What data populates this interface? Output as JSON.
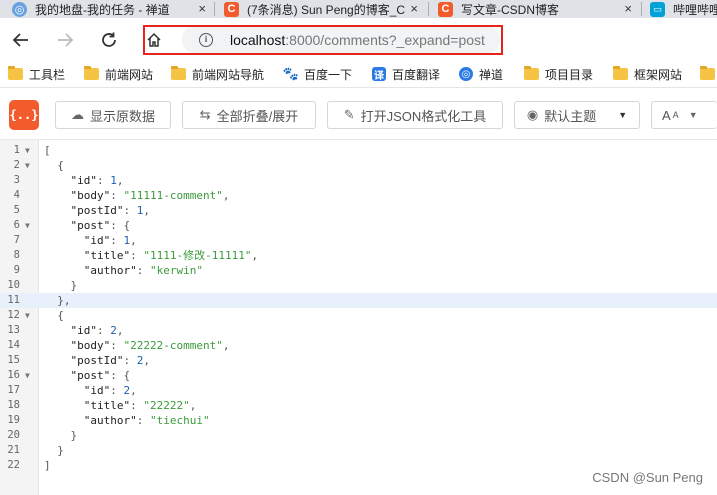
{
  "tabs": [
    {
      "title": "我的地盘-我的任务 - 禅道",
      "icon": "zentao-icon",
      "color": "#6aa1e0",
      "glyph": "禅"
    },
    {
      "title": "(7条消息) Sun Peng的博客_C",
      "icon": "csdn-icon",
      "color": "#f25c2c",
      "glyph": "C"
    },
    {
      "title": "写文章-CSDN博客",
      "icon": "csdn-icon",
      "color": "#f25c2c",
      "glyph": "C"
    },
    {
      "title": "哔哩哔哩",
      "icon": "bilibili-icon",
      "color": "#00a1d6",
      "glyph": "⌂"
    }
  ],
  "address": {
    "host": "localhost",
    "rest": ":8000/comments?_expand=post"
  },
  "bookmarks": [
    {
      "label": "工具栏",
      "icon": "folder-icon"
    },
    {
      "label": "前端网站",
      "icon": "folder-icon"
    },
    {
      "label": "前端网站导航",
      "icon": "folder-icon"
    },
    {
      "label": "百度一下",
      "icon": "baidu-icon"
    },
    {
      "label": "百度翻译",
      "icon": "translate-icon"
    },
    {
      "label": "禅道",
      "icon": "zentao-icon"
    },
    {
      "label": "项目目录",
      "icon": "folder-icon"
    },
    {
      "label": "框架网站",
      "icon": "folder-icon"
    }
  ],
  "toolbar": {
    "logo": "{..}",
    "raw_label": "显示原数据",
    "fold_label": "全部折叠/展开",
    "open_tool_label": "打开JSON格式化工具",
    "theme_label": "默认主题",
    "font_label": "A"
  },
  "code_lines": [
    {
      "n": "1",
      "fold": true,
      "html": "<span class='p'>[</span>"
    },
    {
      "n": "2",
      "fold": true,
      "html": "  <span class='p'>{</span>"
    },
    {
      "n": "3",
      "fold": false,
      "html": "    <span class='k'>\"id\"</span><span class='p'>: </span><span class='n'>1</span><span class='p'>,</span>"
    },
    {
      "n": "4",
      "fold": false,
      "html": "    <span class='k'>\"body\"</span><span class='p'>: </span><span class='s'>\"11111-comment\"</span><span class='p'>,</span>"
    },
    {
      "n": "5",
      "fold": false,
      "html": "    <span class='k'>\"postId\"</span><span class='p'>: </span><span class='n'>1</span><span class='p'>,</span>"
    },
    {
      "n": "6",
      "fold": true,
      "html": "    <span class='k'>\"post\"</span><span class='p'>: {</span>"
    },
    {
      "n": "7",
      "fold": false,
      "html": "      <span class='k'>\"id\"</span><span class='p'>: </span><span class='n'>1</span><span class='p'>,</span>"
    },
    {
      "n": "8",
      "fold": false,
      "html": "      <span class='k'>\"title\"</span><span class='p'>: </span><span class='s'>\"1111-修改-11111\"</span><span class='p'>,</span>"
    },
    {
      "n": "9",
      "fold": false,
      "html": "      <span class='k'>\"author\"</span><span class='p'>: </span><span class='s'>\"kerwin\"</span>"
    },
    {
      "n": "10",
      "fold": false,
      "html": "    <span class='p'>}</span>"
    },
    {
      "n": "11",
      "fold": false,
      "html": "  <span class='p'>},</span>",
      "highlight": true
    },
    {
      "n": "12",
      "fold": true,
      "html": "  <span class='p'>{</span>"
    },
    {
      "n": "13",
      "fold": false,
      "html": "    <span class='k'>\"id\"</span><span class='p'>: </span><span class='n'>2</span><span class='p'>,</span>"
    },
    {
      "n": "14",
      "fold": false,
      "html": "    <span class='k'>\"body\"</span><span class='p'>: </span><span class='s'>\"22222-comment\"</span><span class='p'>,</span>"
    },
    {
      "n": "15",
      "fold": false,
      "html": "    <span class='k'>\"postId\"</span><span class='p'>: </span><span class='n'>2</span><span class='p'>,</span>"
    },
    {
      "n": "16",
      "fold": true,
      "html": "    <span class='k'>\"post\"</span><span class='p'>: {</span>"
    },
    {
      "n": "17",
      "fold": false,
      "html": "      <span class='k'>\"id\"</span><span class='p'>: </span><span class='n'>2</span><span class='p'>,</span>"
    },
    {
      "n": "18",
      "fold": false,
      "html": "      <span class='k'>\"title\"</span><span class='p'>: </span><span class='s'>\"22222\"</span><span class='p'>,</span>"
    },
    {
      "n": "19",
      "fold": false,
      "html": "      <span class='k'>\"author\"</span><span class='p'>: </span><span class='s'>\"tiechui\"</span>"
    },
    {
      "n": "20",
      "fold": false,
      "html": "    <span class='p'>}</span>"
    },
    {
      "n": "21",
      "fold": false,
      "html": "  <span class='p'>}</span>"
    },
    {
      "n": "22",
      "fold": false,
      "html": "<span class='p'>]</span>"
    }
  ],
  "watermark": "CSDN @Sun  Peng",
  "colors": {
    "accent": "#f25c2c",
    "frame": "#e8231c",
    "string": "#3c9a3c",
    "number": "#1a5fb4"
  }
}
